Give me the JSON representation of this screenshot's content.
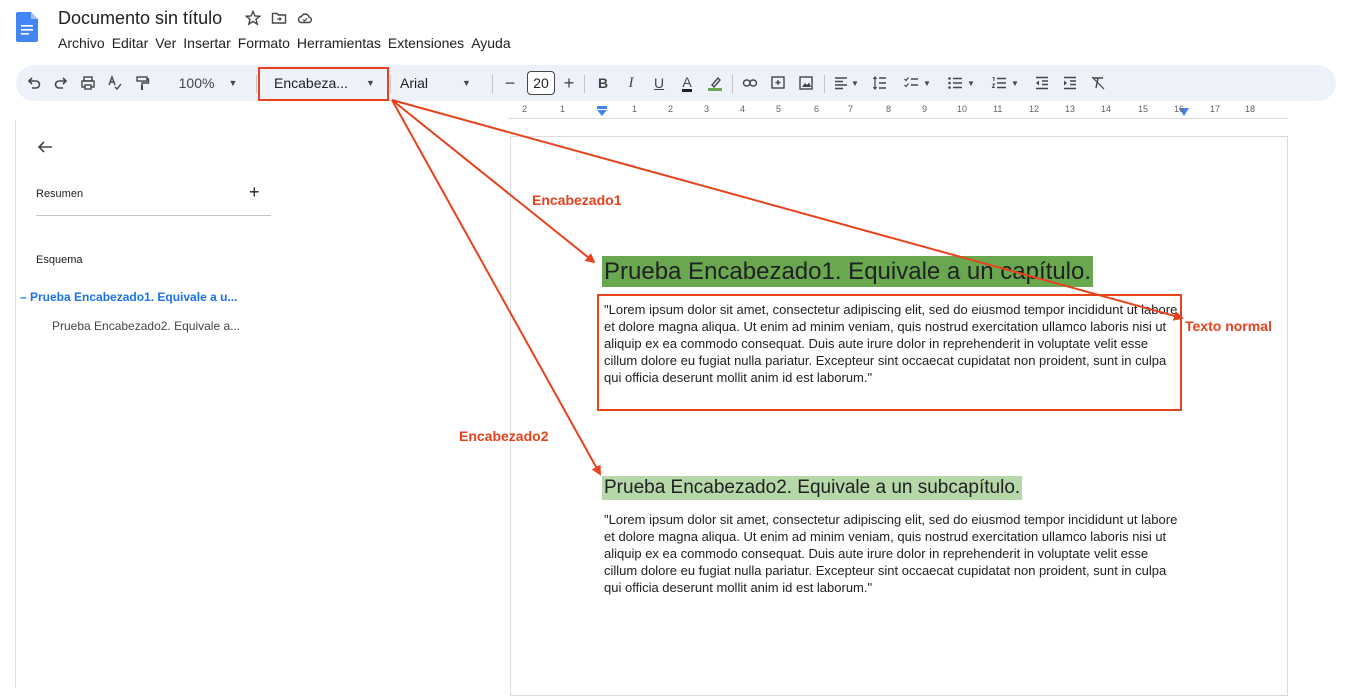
{
  "header": {
    "title": "Documento sin título",
    "menu": [
      "Archivo",
      "Editar",
      "Ver",
      "Insertar",
      "Formato",
      "Herramientas",
      "Extensiones",
      "Ayuda"
    ]
  },
  "toolbar": {
    "zoom": "100%",
    "style": "Encabeza...",
    "font": "Arial",
    "font_size": "20",
    "minus": "−",
    "plus": "+",
    "bold": "B",
    "italic": "I",
    "underline": "U",
    "text_color": "A"
  },
  "ruler": {
    "numbers": [
      "2",
      "1",
      "1",
      "2",
      "3",
      "4",
      "5",
      "6",
      "7",
      "8",
      "9",
      "10",
      "11",
      "12",
      "13",
      "14",
      "15",
      "16",
      "17",
      "18"
    ]
  },
  "sidebar": {
    "resumen": "Resumen",
    "resumen_add": "+",
    "esquema": "Esquema",
    "outline": [
      "– Prueba Encabezado1. Equivale a u...",
      "Prueba Encabezado2. Equivale a..."
    ]
  },
  "document": {
    "heading1": "Prueba Encabezado1. Equivale a un capítulo.",
    "paragraph1": "\"Lorem ipsum dolor sit amet, consectetur adipiscing elit, sed do eiusmod tempor incididunt ut labore et dolore magna aliqua. Ut enim ad minim veniam, quis nostrud exercitation ullamco laboris nisi ut aliquip ex ea commodo consequat. Duis aute irure dolor in reprehenderit in voluptate velit esse cillum dolore eu fugiat nulla pariatur. Excepteur sint occaecat cupidatat non proident, sunt in culpa qui officia deserunt mollit anim id est laborum.\"",
    "heading2": "Prueba Encabezado2. Equivale a un subcapítulo.",
    "paragraph2": "\"Lorem ipsum dolor sit amet, consectetur adipiscing elit, sed do eiusmod tempor incididunt ut labore et dolore magna aliqua. Ut enim ad minim veniam, quis nostrud exercitation ullamco laboris nisi ut aliquip ex ea commodo consequat. Duis aute irure dolor in reprehenderit in voluptate velit esse cillum dolore eu fugiat nulla pariatur. Excepteur sint occaecat cupidatat non proident, sunt in culpa qui officia deserunt mollit anim id est laborum.\""
  },
  "annotations": {
    "encabezado1": "Encabezado1",
    "encabezado2": "Encabezado2",
    "texto_normal": "Texto normal"
  },
  "colors": {
    "accent": "#1a73e8",
    "annotation": "#e8421c",
    "heading1_highlight": "#6aa84f",
    "heading2_highlight": "#b6d7a8",
    "toolbar_bg": "#edf2fa"
  }
}
